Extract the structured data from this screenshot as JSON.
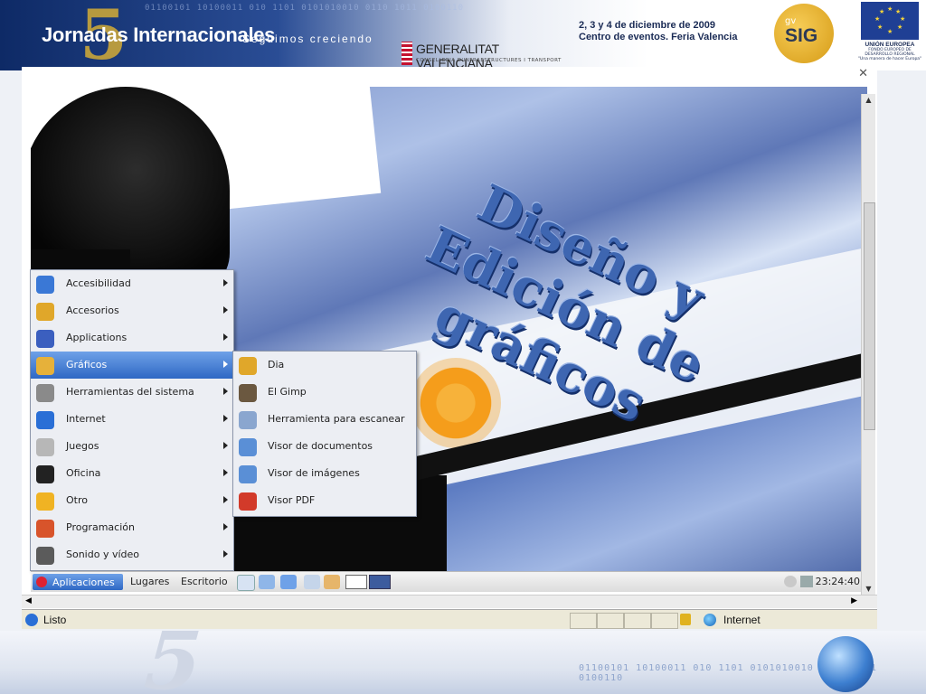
{
  "banner": {
    "event_title": "Jornadas Internacionales",
    "slogan": "Seguimos creciendo",
    "edition_mark": "5",
    "binary_pattern": "01100101 10100011 010 1101 0101010010 0110 1011 0100110",
    "sponsor_name": "GENERALITAT VALENCIANA",
    "sponsor_dept": "CONSELLERIA D'INFRAESTRUCTURES I TRANSPORT",
    "date_line": "2, 3 y 4 de diciembre de 2009",
    "venue_line": "Centro de eventos. Feria Valencia",
    "gvsig_small": "gv",
    "gvsig_logo": "SIG",
    "eu_label": "UNIÓN EUROPEA",
    "eu_fund": "FONDO EUROPEO DE DESARROLLO REGIONAL",
    "eu_motto": "\"Una manera de hacer Europa\""
  },
  "slide_overlay_title": [
    "Diseño y",
    "Edición de",
    "gráficos"
  ],
  "window": {
    "close_glyph": "✕"
  },
  "apps_menu": {
    "items": [
      {
        "label": "Accesibilidad",
        "icon": "accessibility-icon",
        "color": "#3a78d6"
      },
      {
        "label": "Accesorios",
        "icon": "accessories-icon",
        "color": "#e0a72a"
      },
      {
        "label": "Applications",
        "icon": "applications-icon",
        "color": "#3b5fbf"
      },
      {
        "label": "Gráficos",
        "icon": "graphics-icon",
        "color": "#e6b13a"
      },
      {
        "label": "Herramientas del sistema",
        "icon": "system-tools-icon",
        "color": "#8a8a8a"
      },
      {
        "label": "Internet",
        "icon": "internet-icon",
        "color": "#2a6fd6"
      },
      {
        "label": "Juegos",
        "icon": "games-icon",
        "color": "#b7b7b7"
      },
      {
        "label": "Oficina",
        "icon": "office-icon",
        "color": "#222222"
      },
      {
        "label": "Otro",
        "icon": "other-icon",
        "color": "#f0b323"
      },
      {
        "label": "Programación",
        "icon": "programming-icon",
        "color": "#d8542b"
      },
      {
        "label": "Sonido y vídeo",
        "icon": "sound-video-icon",
        "color": "#5b5b5b"
      }
    ],
    "selected_index": 3
  },
  "graphics_submenu": {
    "items": [
      {
        "label": "Dia",
        "icon": "dia-icon",
        "color": "#e0a72a"
      },
      {
        "label": "El Gimp",
        "icon": "gimp-icon",
        "color": "#6b5840"
      },
      {
        "label": "Herramienta para escanear",
        "icon": "scanner-icon",
        "color": "#8aa6cf"
      },
      {
        "label": "Visor de documentos",
        "icon": "document-viewer-icon",
        "color": "#5a8fd6"
      },
      {
        "label": "Visor de imágenes",
        "icon": "image-viewer-icon",
        "color": "#5a8fd6"
      },
      {
        "label": "Visor PDF",
        "icon": "pdf-viewer-icon",
        "color": "#d23a2a"
      }
    ]
  },
  "panel": {
    "applications_label": "Aplicaciones",
    "places_label": "Lugares",
    "desktop_label": "Escritorio",
    "clock": "23:24:40"
  },
  "statusbar": {
    "status_text": "Listo",
    "zone_text": "Internet"
  }
}
